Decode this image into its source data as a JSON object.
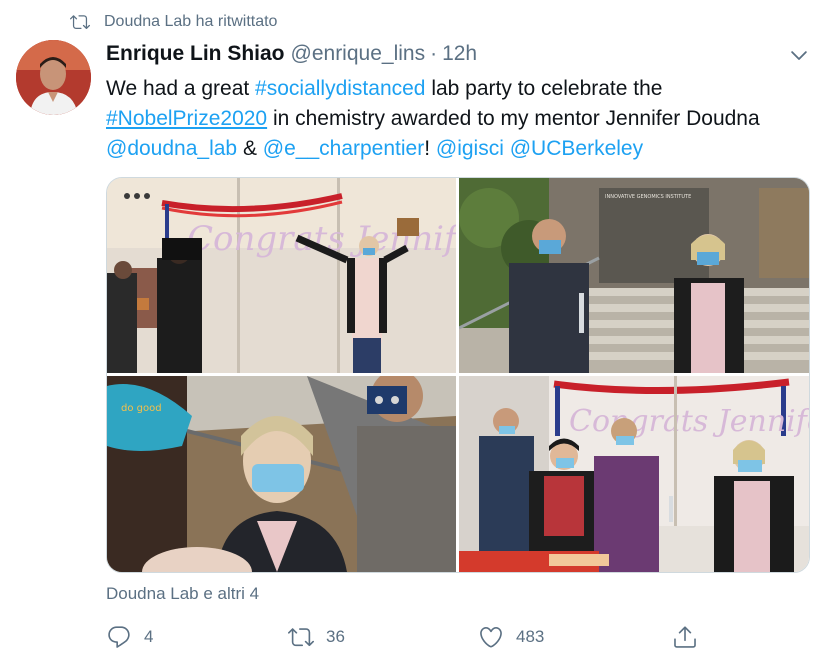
{
  "retweet_banner": {
    "text": "Doudna Lab ha ritwittato",
    "icon": "retweet-icon"
  },
  "tweet": {
    "author_name": "Enrique Lin Shiao",
    "handle": "@enrique_lins",
    "separator": "·",
    "time": "12h",
    "text": {
      "t1": "We had a great ",
      "hashtag1": "#sociallydistanced",
      "t2": " lab party to celebrate the",
      "hashtag2": "#NobelPrize2020",
      "t3": " in chemistry awarded to my mentor Jennifer Doudna",
      "mention1": "@doudna_lab",
      "t4": " & ",
      "mention2": "@e__charpentier",
      "t5": "! ",
      "mention3": "@igisci",
      "t6": " ",
      "mention4": "@UCBerkeley"
    },
    "photos": [
      {
        "banner_text": "Congrats Jennifer"
      },
      {
        "building_sign": "INNOVATIVE GENOMICS INSTITUTE"
      },
      {
        "mask_text": "do good"
      },
      {
        "banner_text": "Congrats Jennifer"
      }
    ],
    "liked_by": "Doudna Lab e altri 4",
    "actions": {
      "reply_count": "4",
      "retweet_count": "36",
      "like_count": "483"
    }
  },
  "colors": {
    "link": "#1da1f2",
    "secondary": "#5b7083",
    "primary": "#0f1419"
  }
}
